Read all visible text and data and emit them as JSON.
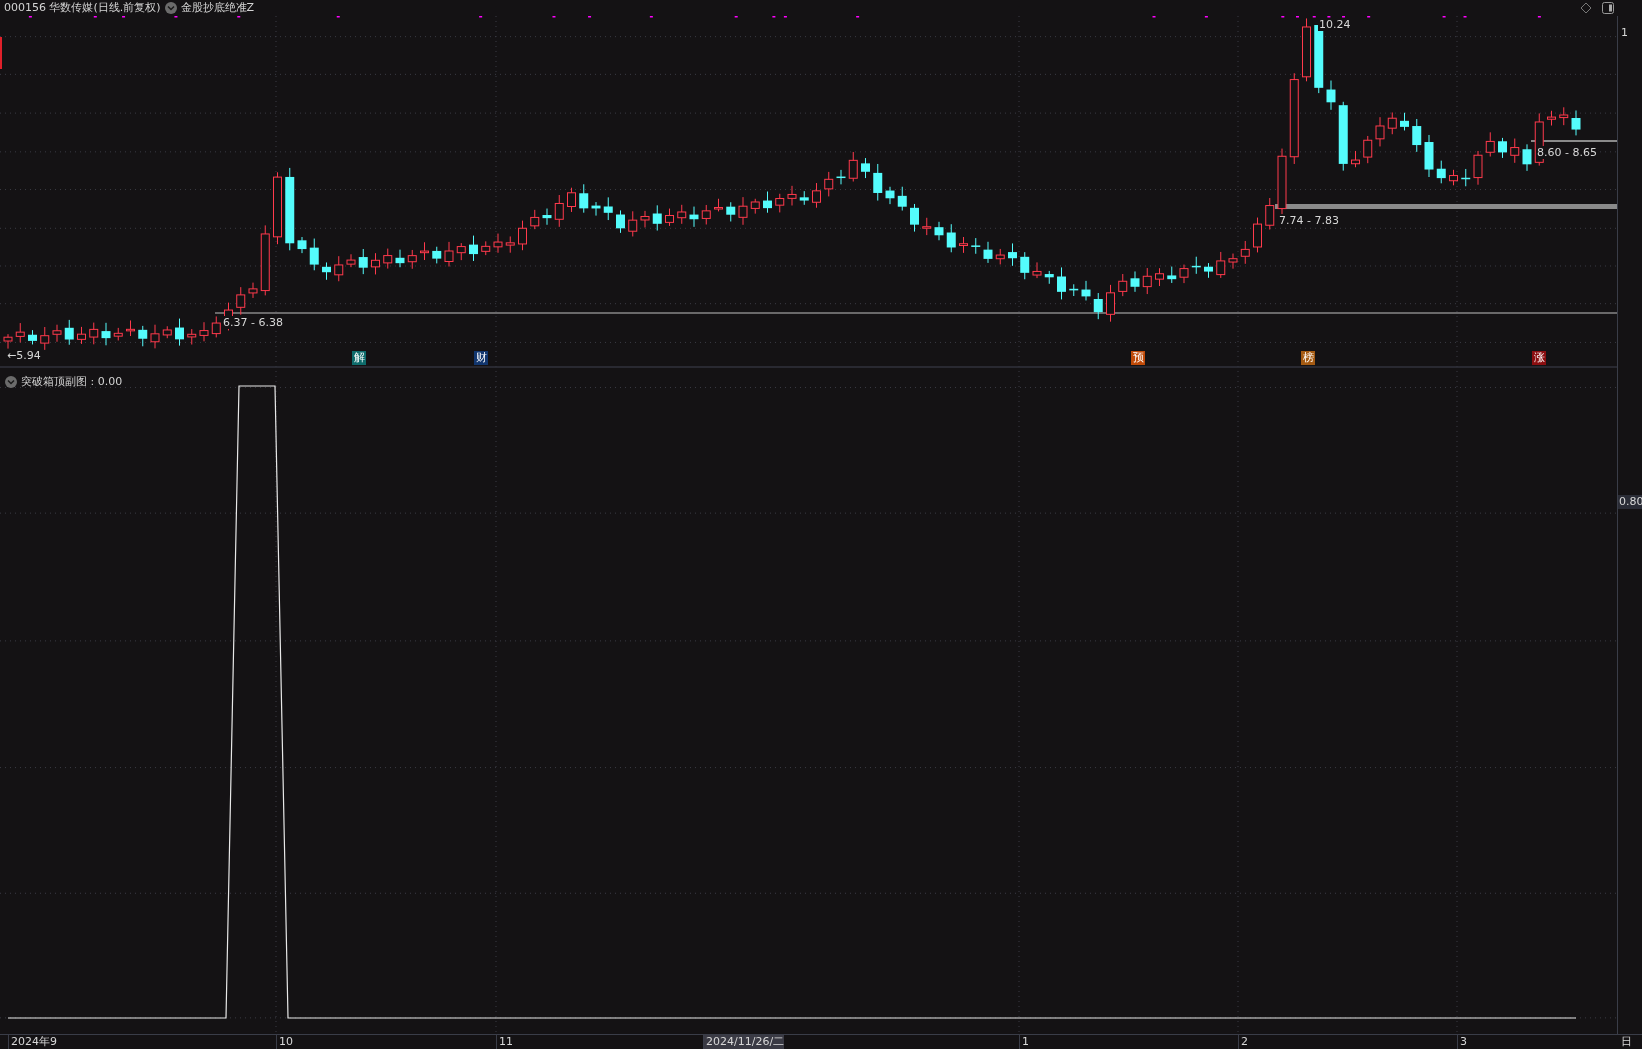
{
  "header": {
    "code_name": "000156 华数传媒(日线.前复权)",
    "indicator": "金股抄底绝准Z"
  },
  "main_chart": {
    "price_labels": [
      "10.24",
      "8.60 - 8.65",
      "7.74 - 7.83",
      "6.37 - 6.38",
      "←5.94"
    ],
    "axis_label": "1",
    "events": [
      {
        "label": "解",
        "color": "#0e6b6b"
      },
      {
        "label": "财",
        "color": "#12366e"
      },
      {
        "label": "预",
        "color": "#c04a08"
      },
      {
        "label": "榜",
        "color": "#a45a12"
      },
      {
        "label": "涨",
        "color": "#8a0e10"
      }
    ]
  },
  "sub_chart": {
    "title": "突破箱顶副图 : 0.00",
    "axis_label": "0.80"
  },
  "x_axis": {
    "labels": [
      "2024年9",
      "10",
      "11",
      "2024/11/26/二",
      "1",
      "2",
      "3"
    ],
    "period": "日"
  }
}
